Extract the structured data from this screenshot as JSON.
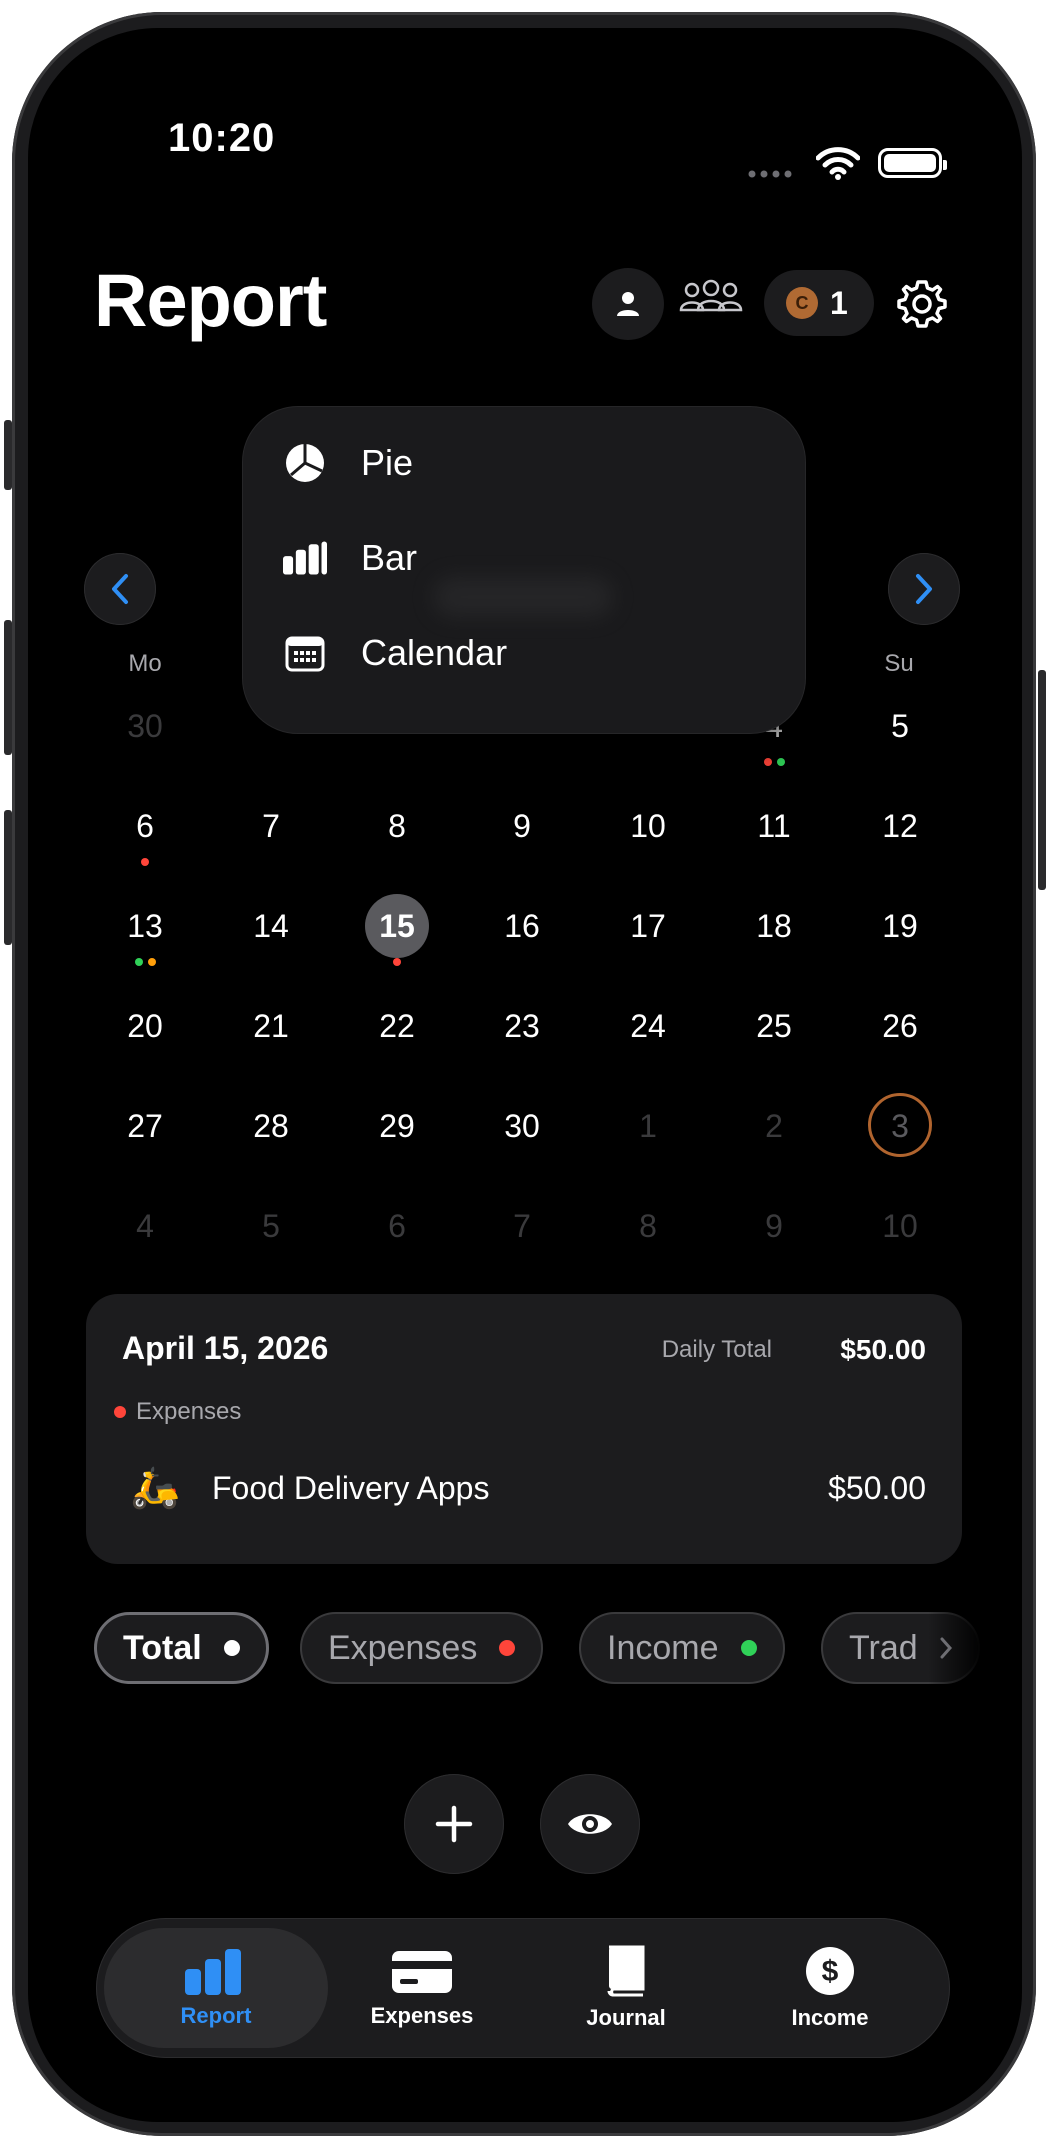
{
  "status_bar": {
    "time": "10:20"
  },
  "header": {
    "title": "Report",
    "coin_count": "1",
    "coin_symbol": "C"
  },
  "chart_menu": {
    "items": [
      {
        "label": "Pie",
        "icon": "pie-chart-icon"
      },
      {
        "label": "Bar",
        "icon": "bar-chart-icon"
      },
      {
        "label": "Calendar",
        "icon": "calendar-icon"
      }
    ]
  },
  "calendar": {
    "weekdays": {
      "mon": "Mo",
      "sun": "Su"
    },
    "rows": [
      [
        "30",
        "",
        "",
        "",
        "",
        "4",
        "5"
      ],
      [
        "6",
        "7",
        "8",
        "9",
        "10",
        "11",
        "12"
      ],
      [
        "13",
        "14",
        "15",
        "16",
        "17",
        "18",
        "19"
      ],
      [
        "20",
        "21",
        "22",
        "23",
        "24",
        "25",
        "26"
      ],
      [
        "27",
        "28",
        "29",
        "30",
        "1",
        "2",
        "3"
      ],
      [
        "4",
        "5",
        "6",
        "7",
        "8",
        "9",
        "10"
      ]
    ],
    "selected_day": "15",
    "today": "3"
  },
  "day_card": {
    "date": "April 15, 2026",
    "daily_total_label": "Daily Total",
    "daily_total_value": "$50.00",
    "category": "Expenses",
    "item_emoji": "🛵",
    "item_name": "Food Delivery Apps",
    "item_amount": "$50.00"
  },
  "filters": [
    {
      "label": "Total",
      "color": "#ffffff",
      "active": true
    },
    {
      "label": "Expenses",
      "color": "#ff453a",
      "active": false
    },
    {
      "label": "Income",
      "color": "#30d158",
      "active": false
    },
    {
      "label": "Trad",
      "color": "",
      "active": false
    }
  ],
  "tabbar": {
    "tabs": [
      {
        "label": "Report",
        "icon": "bar-chart-icon",
        "active": true
      },
      {
        "label": "Expenses",
        "icon": "credit-card-icon",
        "active": false
      },
      {
        "label": "Journal",
        "icon": "book-icon",
        "active": false
      },
      {
        "label": "Income",
        "icon": "dollar-circle-icon",
        "active": false
      }
    ]
  },
  "colors": {
    "accent": "#2f8ff5",
    "expense": "#ff453a",
    "income": "#30d158",
    "other": "#ff9f0a",
    "today_ring": "#b0642e"
  }
}
